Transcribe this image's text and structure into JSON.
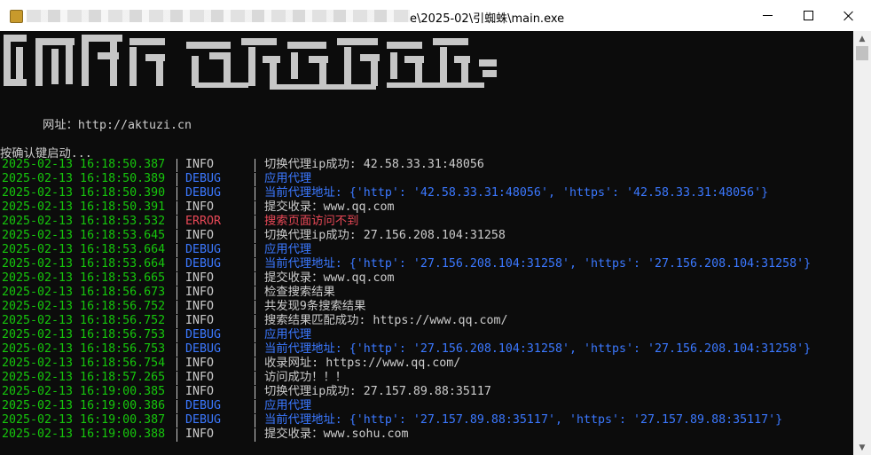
{
  "window": {
    "title_visible": "e\\2025-02\\引蜘蛛\\main.exe",
    "controls": {
      "minimize": "minimize",
      "maximize": "maximize",
      "close": "close"
    }
  },
  "console": {
    "url_line": "      网址：http://aktuzi.cn",
    "start_prompt": "按确认键启动...",
    "colors": {
      "timestamp": "#16c60c",
      "info": "#cccccc",
      "debug": "#3b78ff",
      "error": "#e74856",
      "background": "#0c0c0c"
    },
    "logs": [
      {
        "time": "2025-02-13 16:18:50.387",
        "level": "INFO",
        "message": "切换代理ip成功: 42.58.33.31:48056"
      },
      {
        "time": "2025-02-13 16:18:50.389",
        "level": "DEBUG",
        "message": "应用代理"
      },
      {
        "time": "2025-02-13 16:18:50.390",
        "level": "DEBUG",
        "message": "当前代理地址: {'http': '42.58.33.31:48056', 'https': '42.58.33.31:48056'}"
      },
      {
        "time": "2025-02-13 16:18:50.391",
        "level": "INFO",
        "message": "提交收录：www.qq.com"
      },
      {
        "time": "2025-02-13 16:18:53.532",
        "level": "ERROR",
        "message": "搜索页面访问不到"
      },
      {
        "time": "2025-02-13 16:18:53.645",
        "level": "INFO",
        "message": "切换代理ip成功: 27.156.208.104:31258"
      },
      {
        "time": "2025-02-13 16:18:53.664",
        "level": "DEBUG",
        "message": "应用代理"
      },
      {
        "time": "2025-02-13 16:18:53.664",
        "level": "DEBUG",
        "message": "当前代理地址: {'http': '27.156.208.104:31258', 'https': '27.156.208.104:31258'}"
      },
      {
        "time": "2025-02-13 16:18:53.665",
        "level": "INFO",
        "message": "提交收录：www.qq.com"
      },
      {
        "time": "2025-02-13 16:18:56.673",
        "level": "INFO",
        "message": "检查搜索结果"
      },
      {
        "time": "2025-02-13 16:18:56.752",
        "level": "INFO",
        "message": "共发现9条搜索结果"
      },
      {
        "time": "2025-02-13 16:18:56.752",
        "level": "INFO",
        "message": "搜索结果匹配成功: https://www.qq.com/"
      },
      {
        "time": "2025-02-13 16:18:56.753",
        "level": "DEBUG",
        "message": "应用代理"
      },
      {
        "time": "2025-02-13 16:18:56.753",
        "level": "DEBUG",
        "message": "当前代理地址: {'http': '27.156.208.104:31258', 'https': '27.156.208.104:31258'}"
      },
      {
        "time": "2025-02-13 16:18:56.754",
        "level": "INFO",
        "message": "收录网址: https://www.qq.com/"
      },
      {
        "time": "2025-02-13 16:18:57.265",
        "level": "INFO",
        "message": "访问成功！！！"
      },
      {
        "time": "2025-02-13 16:19:00.385",
        "level": "INFO",
        "message": "切换代理ip成功: 27.157.89.88:35117"
      },
      {
        "time": "2025-02-13 16:19:00.386",
        "level": "DEBUG",
        "message": "应用代理"
      },
      {
        "time": "2025-02-13 16:19:00.387",
        "level": "DEBUG",
        "message": "当前代理地址: {'http': '27.157.89.88:35117', 'https': '27.157.89.88:35117'}"
      },
      {
        "time": "2025-02-13 16:19:00.388",
        "level": "INFO",
        "message": "提交收录：www.sohu.com"
      }
    ]
  }
}
